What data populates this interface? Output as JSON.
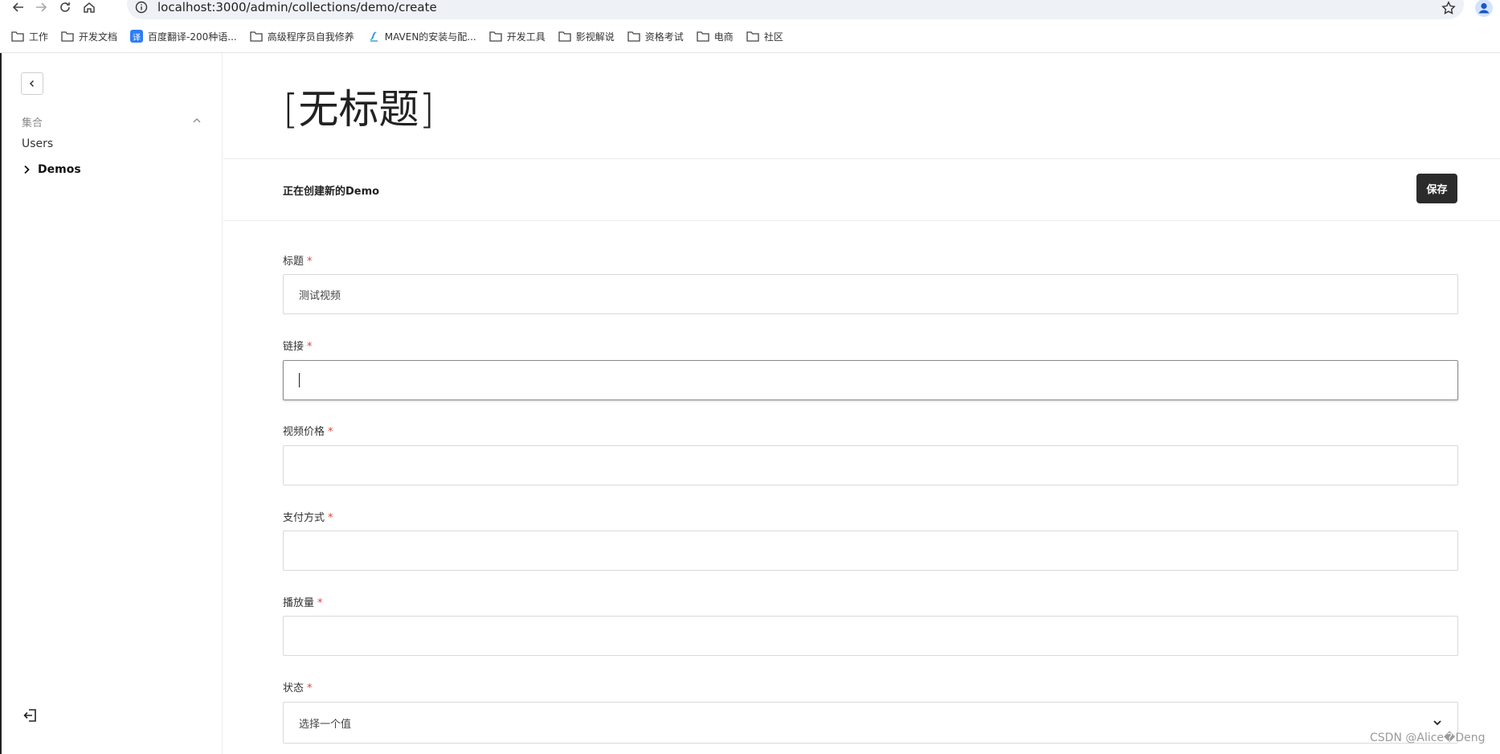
{
  "browser": {
    "url": "localhost:3000/admin/collections/demo/create",
    "bookmarks": [
      {
        "label": "工作",
        "icon": "folder-icon"
      },
      {
        "label": "开发文档",
        "icon": "folder-icon"
      },
      {
        "label": "百度翻译-200种语...",
        "icon": "translate-icon",
        "badge": "译"
      },
      {
        "label": "高级程序员自我修养",
        "icon": "folder-icon"
      },
      {
        "label": "MAVEN的安装与配...",
        "icon": "maven-icon"
      },
      {
        "label": "开发工具",
        "icon": "folder-icon"
      },
      {
        "label": "影视解说",
        "icon": "folder-icon"
      },
      {
        "label": "资格考试",
        "icon": "folder-icon"
      },
      {
        "label": "电商",
        "icon": "folder-icon"
      },
      {
        "label": "社区",
        "icon": "folder-icon"
      }
    ]
  },
  "sidebar": {
    "group_label": "集合",
    "items": [
      {
        "label": "Users",
        "active": false
      },
      {
        "label": "Demos",
        "active": true
      }
    ]
  },
  "main": {
    "title": "[无标题]",
    "creating_text": "正在创建新的Demo",
    "save_label": "保存",
    "fields": [
      {
        "label": "标题",
        "required": "*",
        "value": "测试视频",
        "placeholder": ""
      },
      {
        "label": "链接",
        "required": "*",
        "value": "",
        "focused": true
      },
      {
        "label": "视频价格",
        "required": "*",
        "value": ""
      },
      {
        "label": "支付方式",
        "required": "*",
        "value": ""
      },
      {
        "label": "播放量",
        "required": "*",
        "value": ""
      },
      {
        "label": "状态",
        "required": "*",
        "value": "选择一个值",
        "type": "select"
      }
    ]
  },
  "watermark": "CSDN @Alice�Deng",
  "colors": {
    "primary_button": "#2b2b2b",
    "required_mark": "#e0443a",
    "omnibox_bg": "#eef1f6",
    "bookmark_translate": "#2e7ef7"
  }
}
